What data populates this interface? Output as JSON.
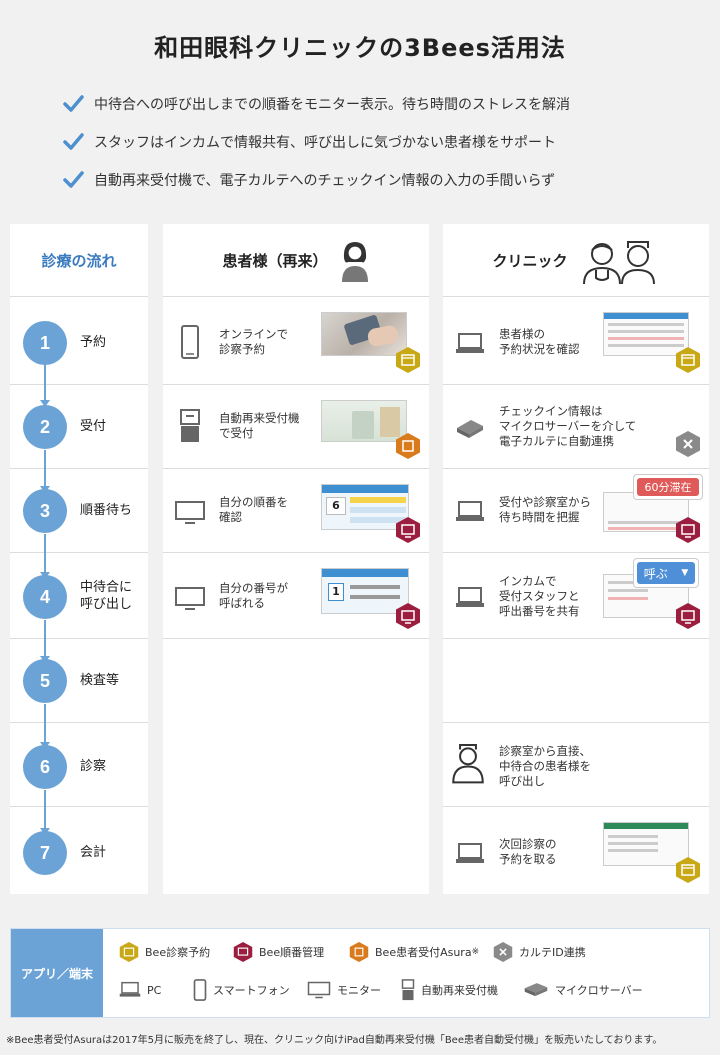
{
  "title": "和田眼科クリニックの3Bees活用法",
  "checks": [
    "中待合への呼び出しまでの順番をモニター表示。待ち時間のストレスを解消",
    "スタッフはインカムで情報共有、呼び出しに気づかない患者様をサポート",
    "自動再来受付機で、電子カルテへのチェックイン情報の入力の手間いらず"
  ],
  "columns": {
    "flow": "診療の流れ",
    "patient": "患者様（再来）",
    "clinic": "クリニック"
  },
  "steps": [
    {
      "num": "1",
      "label": "予約"
    },
    {
      "num": "2",
      "label": "受付"
    },
    {
      "num": "3",
      "label": "順番待ち"
    },
    {
      "num": "4",
      "label": "中待合に\n呼び出し"
    },
    {
      "num": "5",
      "label": "検査等"
    },
    {
      "num": "6",
      "label": "診察"
    },
    {
      "num": "7",
      "label": "会計"
    }
  ],
  "patient_cells": [
    {
      "text": "オンラインで\n診察予約",
      "icon": "smartphone-icon",
      "app": "Bee診察予約"
    },
    {
      "text": "自動再来受付機\nで受付",
      "icon": "kiosk-icon",
      "app": "Bee患者受付Asura"
    },
    {
      "text": "自分の順番を\n確認",
      "icon": "monitor-icon",
      "app": "Bee順番管理"
    },
    {
      "text": "自分の番号が\n呼ばれる",
      "icon": "monitor-icon",
      "app": "Bee順番管理"
    }
  ],
  "clinic_cells": [
    {
      "text": "患者様の\n予約状況を確認",
      "icon": "pc-icon",
      "app": "Bee診察予約"
    },
    {
      "text": "チェックイン情報は\nマイクロサーバーを介して\n電子カルテに自動連携",
      "icon": "micro-server-icon",
      "app": "カルテID連携"
    },
    {
      "text": "受付や診察室から\n待ち時間を把握",
      "icon": "pc-icon",
      "app": "Bee順番管理",
      "badge": "60分滞在"
    },
    {
      "text": "インカムで\n受付スタッフと\n呼出番号を共有",
      "icon": "pc-icon",
      "app": "Bee順番管理",
      "badge": "呼ぶ"
    },
    {
      "text": "診察室から直接、\n中待合の患者様を\n呼び出し",
      "icon": "nurse-icon"
    },
    {
      "text": "次回診察の\n予約を取る",
      "icon": "pc-icon",
      "app": "Bee診察予約"
    }
  ],
  "screen_texts": {
    "queue_number": "6",
    "called_number": "1"
  },
  "legend": {
    "label": "アプリ／端末",
    "apps": [
      "Bee診察予約",
      "Bee順番管理",
      "Bee患者受付Asura",
      "カルテID連携"
    ],
    "asura_mark": "※",
    "devices": [
      "PC",
      "スマートフォン",
      "モニター",
      "自動再来受付機",
      "マイクロサーバー"
    ]
  },
  "footnote": "※Bee患者受付Asuraは2017年5月に販売を終了し、現在、クリニック向けiPad自動再来受付機「Bee患者自動受付機」を販売いたしております。",
  "colors": {
    "accent_blue": "#6ba3d6",
    "reserve_gold": "#c9a816",
    "queue_red": "#9b1e3f",
    "asura_orange": "#d97a1c",
    "karte_gray": "#8a8a8a",
    "badge_red": "#e15a5a",
    "badge_blue": "#4f8fd8"
  }
}
